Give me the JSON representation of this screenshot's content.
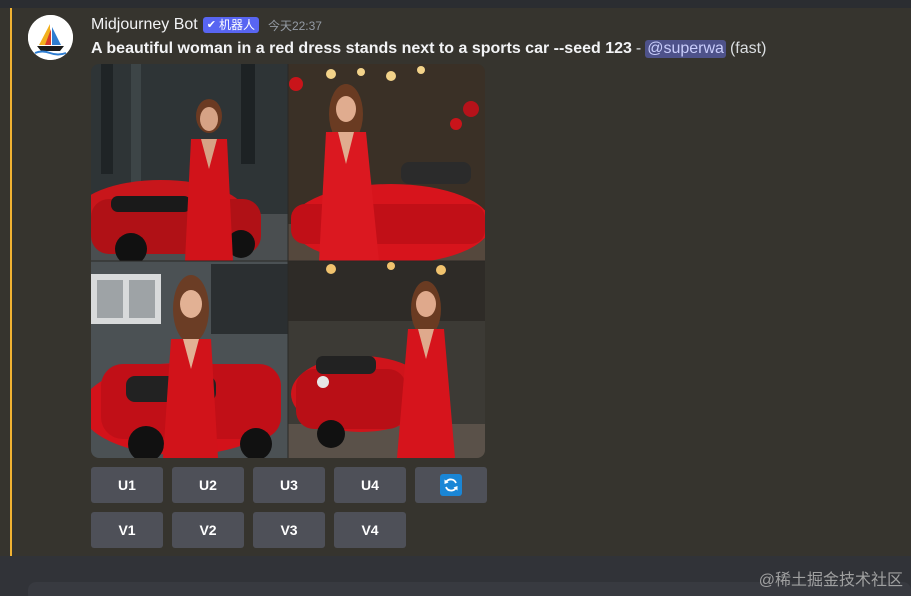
{
  "message": {
    "author": "Midjourney Bot",
    "bot_tag": "机器人",
    "timestamp": "今天22:37",
    "prompt": "A beautiful woman in a red dress stands next to a sports car --seed 123",
    "separator": "-",
    "mention": "@superwa",
    "speed": "(fast)",
    "image_alt": "4-image grid of a woman in a red dress beside red sports cars"
  },
  "buttons": {
    "row1": [
      "U1",
      "U2",
      "U3",
      "U4"
    ],
    "row2": [
      "V1",
      "V2",
      "V3",
      "V4"
    ],
    "reroll_icon": "refresh-icon"
  },
  "colors": {
    "highlight": "#f0b232",
    "bot_tag": "#5865f2",
    "mention_bg": "#4e528a",
    "button": "#4e5058",
    "reroll": "#1a86d6"
  },
  "watermark": "@稀土掘金技术社区"
}
